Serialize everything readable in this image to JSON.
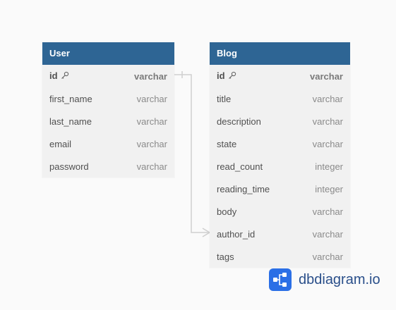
{
  "tables": [
    {
      "name": "User",
      "columns": [
        {
          "name": "id",
          "type": "varchar",
          "pk": true
        },
        {
          "name": "first_name",
          "type": "varchar",
          "pk": false
        },
        {
          "name": "last_name",
          "type": "varchar",
          "pk": false
        },
        {
          "name": "email",
          "type": "varchar",
          "pk": false
        },
        {
          "name": "password",
          "type": "varchar",
          "pk": false
        }
      ]
    },
    {
      "name": "Blog",
      "columns": [
        {
          "name": "id",
          "type": "varchar",
          "pk": true
        },
        {
          "name": "title",
          "type": "varchar",
          "pk": false
        },
        {
          "name": "description",
          "type": "varchar",
          "pk": false
        },
        {
          "name": "state",
          "type": "varchar",
          "pk": false
        },
        {
          "name": "read_count",
          "type": "integer",
          "pk": false
        },
        {
          "name": "reading_time",
          "type": "integer",
          "pk": false
        },
        {
          "name": "body",
          "type": "varchar",
          "pk": false
        },
        {
          "name": "author_id",
          "type": "varchar",
          "pk": false
        },
        {
          "name": "tags",
          "type": "varchar",
          "pk": false
        }
      ]
    }
  ],
  "relation": {
    "from": "User.id",
    "to": "Blog.author_id",
    "type": "one-to-many"
  },
  "brand": {
    "text": "dbdiagram.io",
    "logo_icon": "dbdiagram-logo-icon",
    "color": "#2b6fe6"
  },
  "colors": {
    "header": "#2e6594",
    "table_bg": "#f1f1f1"
  }
}
